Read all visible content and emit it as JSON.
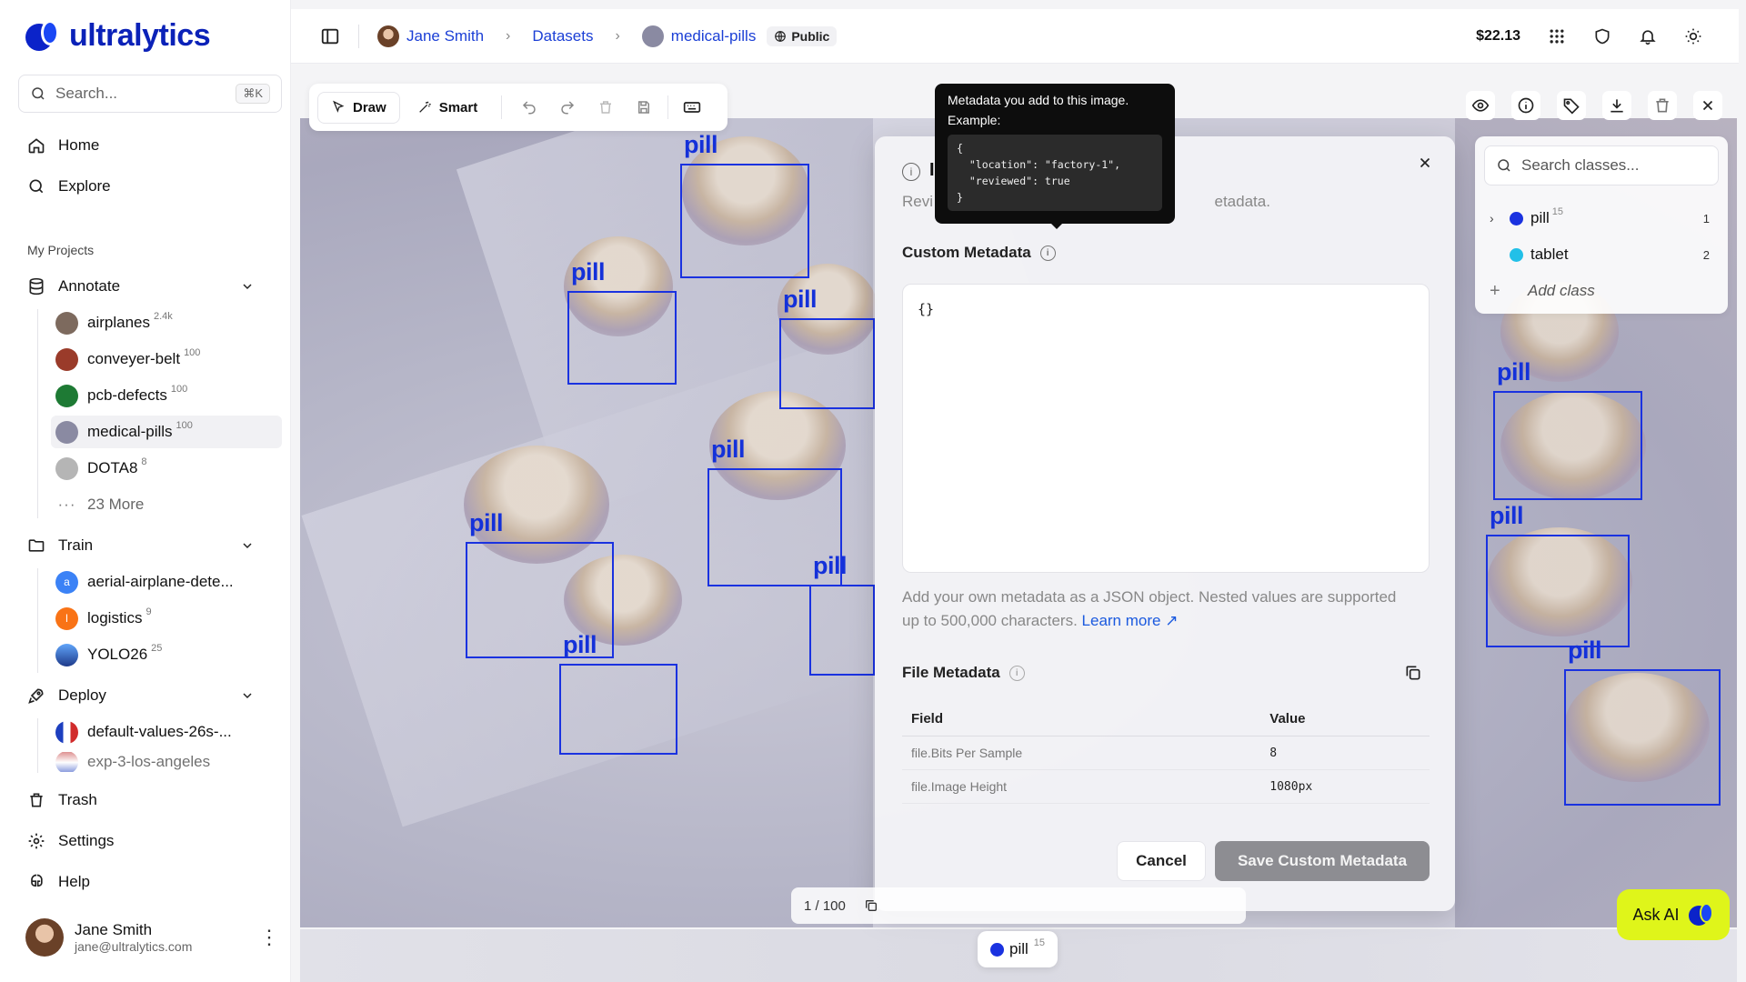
{
  "app": {
    "logo_text": "ultralytics"
  },
  "sidebar": {
    "search_placeholder": "Search...",
    "search_shortcut": "⌘K",
    "nav": [
      {
        "label": "Home",
        "icon": "home-icon"
      },
      {
        "label": "Explore",
        "icon": "search-icon"
      }
    ],
    "section_label": "My Projects",
    "annotate": {
      "label": "Annotate",
      "items": [
        {
          "label": "airplanes",
          "count": "2.4k",
          "color": "#7d6a5e"
        },
        {
          "label": "conveyer-belt",
          "count": "100",
          "color": "#9a3b2a"
        },
        {
          "label": "pcb-defects",
          "count": "100",
          "color": "#1e7a34"
        },
        {
          "label": "medical-pills",
          "count": "100",
          "color": "#8a8aa2",
          "active": true
        },
        {
          "label": "DOTA8",
          "count": "8",
          "color": "#b5b5b5"
        }
      ],
      "more_label": "23 More"
    },
    "train": {
      "label": "Train",
      "items": [
        {
          "label": "aerial-airplane-dete...",
          "count": "",
          "color": "#3b82f6",
          "letter": "a"
        },
        {
          "label": "logistics",
          "count": "9",
          "color": "#f97316",
          "letter": "l"
        },
        {
          "label": "YOLO26",
          "count": "25",
          "color": "#1e40af"
        }
      ]
    },
    "deploy": {
      "label": "Deploy",
      "items": [
        {
          "label": "default-values-26s-...",
          "count": "",
          "color": "#1d3fbf"
        },
        {
          "label": "exp-3-los-angeles",
          "count": "",
          "color": "#c43a3a"
        }
      ]
    },
    "bottom_nav": [
      {
        "label": "Trash",
        "icon": "trash-icon"
      },
      {
        "label": "Settings",
        "icon": "gear-icon"
      },
      {
        "label": "Help",
        "icon": "help-icon"
      }
    ],
    "user": {
      "name": "Jane Smith",
      "email": "jane@ultralytics.com"
    }
  },
  "topbar": {
    "breadcrumb": [
      "Jane Smith",
      "Datasets",
      "medical-pills"
    ],
    "visibility": "Public",
    "balance": "$22.13"
  },
  "toolbar": {
    "draw_label": "Draw",
    "smart_label": "Smart"
  },
  "canvas": {
    "box_label": "pill"
  },
  "classes_panel": {
    "search_placeholder": "Search classes...",
    "classes": [
      {
        "name": "pill",
        "sup": "15",
        "count": "1",
        "color": "#1a32e0"
      },
      {
        "name": "tablet",
        "sup": "",
        "count": "2",
        "color": "#22c0e8"
      }
    ],
    "add_label": "Add class"
  },
  "tooltip": {
    "text": "Metadata you add to this image.",
    "example_label": "Example:",
    "example_code": "{\n  \"location\": \"factory-1\",\n  \"reviewed\": true\n}"
  },
  "modal": {
    "title_initial": "I",
    "desc_left": "Revi",
    "desc_right": "etadata.",
    "custom_label": "Custom Metadata",
    "json_value": "{}",
    "help_text": "Add your own metadata as a JSON object. Nested values are supported up to 500,000 characters.",
    "learn_more": "Learn more ↗",
    "file_label": "File Metadata",
    "table_headers": [
      "Field",
      "Value"
    ],
    "table_rows": [
      [
        "file.Bits Per Sample",
        "8"
      ],
      [
        "file.Image Height",
        "1080px"
      ]
    ],
    "cancel_label": "Cancel",
    "save_label": "Save Custom Metadata"
  },
  "pager": {
    "text": "1 / 100"
  },
  "chip": {
    "name": "pill",
    "sup": "15",
    "color": "#1a32e0"
  },
  "ask_ai": {
    "label": "Ask AI"
  }
}
